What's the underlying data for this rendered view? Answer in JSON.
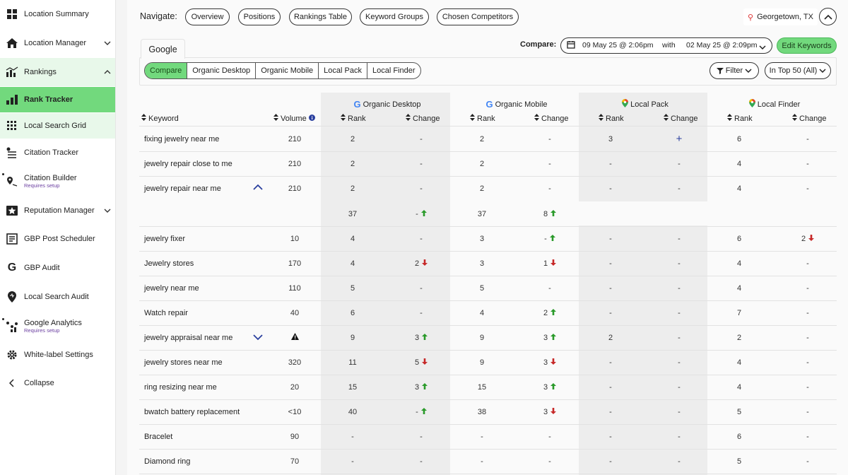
{
  "sidebar": {
    "items": [
      {
        "label": "Location Summary",
        "icon": "grid-icon"
      },
      {
        "label": "Location Manager",
        "icon": "home-icon"
      },
      {
        "label": "Rankings",
        "icon": "bar-chart-icon"
      },
      {
        "label": "Rank Tracker",
        "icon": "rank-bars-icon"
      },
      {
        "label": "Local Search Grid",
        "icon": "dot-grid-icon"
      },
      {
        "label": "Citation Tracker",
        "icon": "citation-icon"
      },
      {
        "label": "Citation Builder",
        "sub": "Requires setup",
        "icon": "pin-route-icon"
      },
      {
        "label": "Reputation Manager",
        "icon": "star-box-icon"
      },
      {
        "label": "GBP Post Scheduler",
        "icon": "post-icon"
      },
      {
        "label": "GBP Audit",
        "icon": "google-g-icon"
      },
      {
        "label": "Local Search Audit",
        "icon": "pin-heart-icon"
      },
      {
        "label": "Google Analytics",
        "sub": "Requires setup",
        "icon": "analytics-icon"
      },
      {
        "label": "White-label Settings",
        "icon": "gear-icon"
      },
      {
        "label": "Collapse",
        "icon": "chevron-left-icon"
      }
    ]
  },
  "nav": {
    "label": "Navigate:",
    "pills": [
      "Overview",
      "Positions",
      "Rankings Table",
      "Keyword Groups",
      "Chosen Competitors"
    ],
    "location": "Georgetown, TX"
  },
  "tabs": {
    "engine": "Google",
    "segments": [
      "Compare",
      "Organic Desktop",
      "Organic Mobile",
      "Local Pack",
      "Local Finder"
    ],
    "active": "Compare"
  },
  "compare": {
    "label": "Compare:",
    "date1": "09 May 25 @ 2:06pm",
    "with": "with",
    "date2": "02 May 25 @ 2:09pm",
    "edit": "Edit Keywords"
  },
  "filters": {
    "filter": "Filter",
    "top": "In Top 50 (All)"
  },
  "columns": {
    "keyword": "Keyword",
    "volume": "Volume",
    "groups": [
      "Organic Desktop",
      "Organic Mobile",
      "Local Pack",
      "Local Finder"
    ],
    "rank": "Rank",
    "change": "Change"
  },
  "rows": [
    {
      "kw": "fixing jewelry near me",
      "vol": "210",
      "c": [
        [
          "2",
          "-",
          ""
        ],
        [
          "2",
          "-",
          ""
        ],
        [
          "3",
          "+",
          ""
        ],
        [
          "6",
          "-",
          ""
        ]
      ]
    },
    {
      "kw": "jewelry repair close to me",
      "vol": "210",
      "c": [
        [
          "2",
          "-",
          ""
        ],
        [
          "2",
          "-",
          ""
        ],
        [
          "-",
          "-",
          ""
        ],
        [
          "4",
          "-",
          ""
        ]
      ]
    },
    {
      "kw": "jewelry repair near me",
      "vol": "210",
      "c": [
        [
          "2",
          "-",
          ""
        ],
        [
          "2",
          "-",
          ""
        ],
        [
          "-",
          "-",
          ""
        ],
        [
          "4",
          "-",
          ""
        ]
      ]
    },
    {
      "kw": "",
      "vol": "",
      "c": [
        [
          "37",
          "-",
          "up"
        ],
        [
          "37",
          "8",
          "up"
        ],
        [
          "",
          "",
          " "
        ],
        [
          "",
          "",
          " "
        ]
      ]
    },
    {
      "kw": "jewelry fixer",
      "vol": "10",
      "c": [
        [
          "4",
          "-",
          ""
        ],
        [
          "3",
          "-",
          "up"
        ],
        [
          "-",
          "-",
          ""
        ],
        [
          "6",
          "2",
          "dn"
        ]
      ]
    },
    {
      "kw": "Jewelry stores",
      "vol": "170",
      "c": [
        [
          "4",
          "2",
          "dn"
        ],
        [
          "3",
          "1",
          "dn"
        ],
        [
          "-",
          "-",
          ""
        ],
        [
          "4",
          "-",
          ""
        ]
      ]
    },
    {
      "kw": "jewelry near me",
      "vol": "110",
      "c": [
        [
          "5",
          "-",
          ""
        ],
        [
          "5",
          "-",
          ""
        ],
        [
          "-",
          "-",
          ""
        ],
        [
          "4",
          "-",
          ""
        ]
      ]
    },
    {
      "kw": "Watch repair",
      "vol": "40",
      "c": [
        [
          "6",
          "-",
          ""
        ],
        [
          "4",
          "2",
          "up"
        ],
        [
          "-",
          "-",
          ""
        ],
        [
          "7",
          "-",
          ""
        ]
      ]
    },
    {
      "kw": "jewelry appraisal near me",
      "vol": "",
      "c": [
        [
          "9",
          "3",
          "up"
        ],
        [
          "9",
          "3",
          "up"
        ],
        [
          "2",
          "-",
          ""
        ],
        [
          "2",
          "-",
          ""
        ]
      ]
    },
    {
      "kw": "jewelry stores near me",
      "vol": "320",
      "c": [
        [
          "11",
          "5",
          "dn"
        ],
        [
          "9",
          "3",
          "dn"
        ],
        [
          "-",
          "-",
          ""
        ],
        [
          "4",
          "-",
          ""
        ]
      ]
    },
    {
      "kw": "ring resizing near me",
      "vol": "20",
      "c": [
        [
          "15",
          "3",
          "up"
        ],
        [
          "15",
          "3",
          "up"
        ],
        [
          "-",
          "-",
          ""
        ],
        [
          "4",
          "-",
          ""
        ]
      ]
    },
    {
      "kw": "bwatch battery replacement",
      "vol": "<10",
      "c": [
        [
          "40",
          "-",
          "up"
        ],
        [
          "38",
          "3",
          "dn"
        ],
        [
          "-",
          "-",
          ""
        ],
        [
          "5",
          "-",
          ""
        ]
      ]
    },
    {
      "kw": "Bracelet",
      "vol": "90",
      "c": [
        [
          "-",
          "-",
          ""
        ],
        [
          "-",
          "-",
          ""
        ],
        [
          "-",
          "-",
          ""
        ],
        [
          "6",
          "-",
          ""
        ]
      ]
    },
    {
      "kw": "Diamond ring",
      "vol": "70",
      "c": [
        [
          "-",
          "-",
          ""
        ],
        [
          "-",
          "-",
          ""
        ],
        [
          "-",
          "-",
          ""
        ],
        [
          "5",
          "-",
          ""
        ]
      ]
    }
  ],
  "colors": {
    "accent": "#72d97d",
    "active_bg": "#e8f8ea",
    "up": "#2a9a2a",
    "down": "#c62828"
  }
}
